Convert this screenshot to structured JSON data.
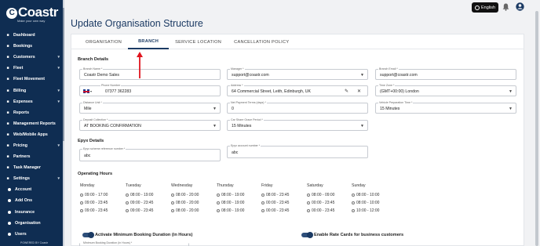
{
  "app": {
    "logo": "Coastr",
    "tagline": "Make your own way",
    "powered_by": "POWERED BY Coastr"
  },
  "topbar": {
    "language": "English"
  },
  "sidebar": {
    "items": [
      {
        "label": "Dashboard",
        "icon": "dashboard-icon",
        "chevron": false
      },
      {
        "label": "Bookings",
        "icon": "bookings-icon",
        "chevron": false
      },
      {
        "label": "Customers",
        "icon": "customers-icon",
        "chevron": true
      },
      {
        "label": "Fleet",
        "icon": "fleet-icon",
        "chevron": true
      },
      {
        "label": "Fleet Movement",
        "icon": "fleet-movement-icon",
        "chevron": false
      },
      {
        "label": "Billing",
        "icon": "billing-icon",
        "chevron": true
      },
      {
        "label": "Expenses",
        "icon": "expenses-icon",
        "chevron": true
      },
      {
        "label": "Reports",
        "icon": "reports-icon",
        "chevron": false
      },
      {
        "label": "Management Reports",
        "icon": "management-reports-icon",
        "chevron": false
      },
      {
        "label": "Web/Mobile Apps",
        "icon": "apps-icon",
        "chevron": false
      },
      {
        "label": "Pricing",
        "icon": "pricing-icon",
        "chevron": true
      },
      {
        "label": "Partners",
        "icon": "partners-icon",
        "chevron": false
      },
      {
        "label": "Task Manager",
        "icon": "task-manager-icon",
        "chevron": false
      },
      {
        "label": "Settings",
        "icon": "settings-icon",
        "chevron": true
      }
    ],
    "sub_items": [
      "Account",
      "Add Ons",
      "Insurance",
      "Organisation",
      "Users"
    ]
  },
  "page": {
    "title": "Update Organisation Structure"
  },
  "tabs": [
    "ORGANISATION",
    "BRANCH",
    "SERVICE LOCATION",
    "CANCELLATION POLICY"
  ],
  "branch_details": {
    "heading": "Branch Details",
    "branch_name": {
      "label": "Branch Name *",
      "value": "Coastr Demo Sales"
    },
    "manager": {
      "label": "Manager *",
      "value": "support@coastr.com"
    },
    "branch_email": {
      "label": "Branch Email *",
      "value": "support@coastr.com"
    },
    "phone_number": {
      "label": "Phone Number",
      "value": "07377 362283"
    },
    "address": {
      "label": "Address *",
      "value": "64 Commercial Street, Leith, Edinburgh, UK"
    },
    "time_zone": {
      "label": "Time Zone *",
      "value": "(GMT+00:00) London"
    },
    "distance_unit": {
      "label": "Distance Unit *",
      "value": "Mile"
    },
    "net_payment_terms": {
      "label": "Net Payment Terms (days) *",
      "value": "0"
    },
    "vehicle_prep_time": {
      "label": "Vehicle Preparation Time *",
      "value": "15 Minutes"
    },
    "deposit_collection": {
      "label": "Deposit Collection *",
      "value": "AT BOOKING CONFIRMATION"
    },
    "car_share_grace": {
      "label": "Car Share Grace Period *",
      "value": "15 Minutes"
    }
  },
  "epyx": {
    "heading": "Epyx Details",
    "scheme_ref": {
      "label": "Epyx scheme reference number *",
      "value": "abc"
    },
    "account_number": {
      "label": "Epyx account number *",
      "value": "abc"
    }
  },
  "operating_hours": {
    "heading": "Operating Hours",
    "days": [
      {
        "name": "Monday",
        "slots": [
          "09:00 - 17:00",
          "09:00 - 23:45",
          "09:00 - 23:45"
        ]
      },
      {
        "name": "Tuesday",
        "slots": [
          "08:00 - 19:00",
          "09:00 - 23:45",
          "09:00 - 23:45"
        ]
      },
      {
        "name": "Wednesday",
        "slots": [
          "08:00 - 20:00",
          "08:00 - 20:00",
          "08:00 - 20:00"
        ]
      },
      {
        "name": "Thursday",
        "slots": [
          "08:00 - 19:00",
          "08:00 - 19:00",
          "08:00 - 19:00"
        ]
      },
      {
        "name": "Friday",
        "slots": [
          "08:00 - 23:45",
          "00:00 - 23:45",
          "00:00 - 23:45"
        ]
      },
      {
        "name": "Saturday",
        "slots": [
          "08:00 - 09:00",
          "00:00 - 23:45",
          "00:00 - 23:45"
        ]
      },
      {
        "name": "Sunday",
        "slots": [
          "08:00 - 10:00",
          "08:00 - 10:00",
          "10:00 - 12:00"
        ]
      }
    ]
  },
  "toggles": {
    "min_booking": "Activate Minimum Booking Duration (in Hours)",
    "rate_cards": "Enable Rate Cards for business customers",
    "min_booking_field_label": "Minimum Booking Duration (in Hours) *"
  }
}
